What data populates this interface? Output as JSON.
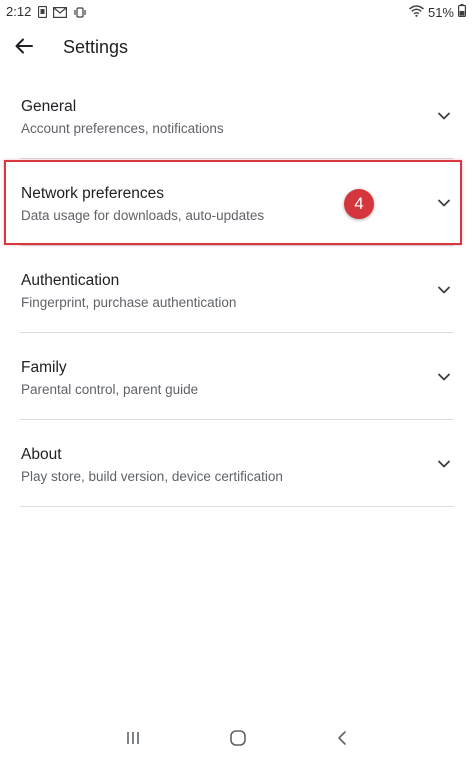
{
  "status_bar": {
    "time": "2:12",
    "battery": "51%",
    "icons": [
      "notification-icon",
      "mail-icon",
      "vibrate-icon",
      "wifi-icon",
      "battery-icon"
    ]
  },
  "app_bar": {
    "title": "Settings",
    "back_icon": "arrow-back-icon"
  },
  "settings": {
    "items": [
      {
        "title": "General",
        "subtitle": "Account preferences, notifications"
      },
      {
        "title": "Network preferences",
        "subtitle": "Data usage for downloads, auto-updates"
      },
      {
        "title": "Authentication",
        "subtitle": "Fingerprint, purchase authentication"
      },
      {
        "title": "Family",
        "subtitle": "Parental control, parent guide"
      },
      {
        "title": "About",
        "subtitle": "Play store, build version, device certification"
      }
    ]
  },
  "annotation": {
    "step_number": "4",
    "highlight_color": "#d7373f"
  },
  "nav_bar": {
    "icons": [
      "recent-apps-icon",
      "home-icon",
      "back-nav-icon"
    ]
  }
}
